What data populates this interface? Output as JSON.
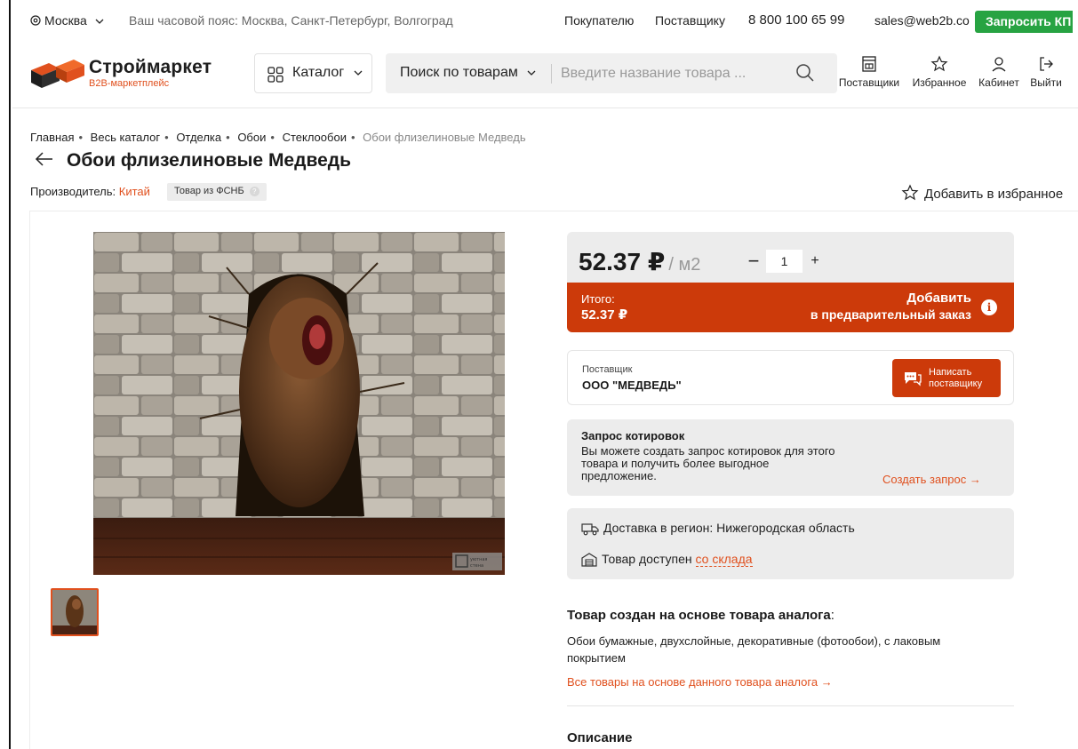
{
  "topbar": {
    "city": "Москва",
    "timezone": "Ваш часовой пояс: Москва, Санкт-Петербург, Волгоград",
    "buyer_link": "Покупателю",
    "supplier_link": "Поставщику",
    "phone": "8 800 100 65 99",
    "email": "sales@web2b.co",
    "kp_button": "Запросить КП"
  },
  "header": {
    "brand": "Строймаркет",
    "brand_sub": "B2B-маркетплейс",
    "catalog": "Каталог",
    "search_mode": "Поиск по товарам",
    "search_placeholder": "Введите название товара ...",
    "nav": {
      "suppliers": "Поставщики",
      "favorites": "Избранное",
      "cabinet": "Кабинет",
      "logout": "Выйти"
    }
  },
  "breadcrumb": {
    "items": [
      "Главная",
      "Весь каталог",
      "Отделка",
      "Обои",
      "Стеклообои"
    ],
    "current": "Обои флизелиновые Медведь"
  },
  "product": {
    "title": "Обои флизелиновые Медведь",
    "maker_label": "Производитель:",
    "maker_country": "Китай",
    "fsnb_badge": "Товар из ФСНБ",
    "fsnb_hint": "?",
    "add_favorite": "Добавить в избранное",
    "watermark": "уютная стена"
  },
  "price": {
    "value": "52.37 ₽",
    "unit": "/ м2",
    "qty_minus": "−",
    "quantity": "1",
    "qty_plus": "+",
    "total_label": "Итого:",
    "total_value": "52.37 ₽",
    "add_line1": "Добавить",
    "add_line2": "в предварительный заказ",
    "info": "i"
  },
  "supplier": {
    "label": "Поставщик",
    "name": "ООО \"МЕДВЕДЬ\"",
    "write_line1": "Написать",
    "write_line2": "поставщику"
  },
  "quote": {
    "title": "Запрос котировок",
    "text": "Вы можете создать запрос котировок для этого товара и получить более выгодное предложение.",
    "link": "Создать запрос →"
  },
  "delivery": {
    "region": "Доставка в регион: Нижегородская область",
    "stock_text": "Товар доступен",
    "stock_link": "со склада"
  },
  "analog": {
    "title": "Товар создан на основе товара аналога",
    "colon": ":",
    "text": "Обои бумажные, двухслойные, декоративные (фотообои), с лаковым покрытием",
    "link": "Все товары на основе данного товара аналога →"
  },
  "description": {
    "title": "Описание"
  },
  "colors": {
    "accent": "#e0501e",
    "order_bar": "#cc3a0a",
    "kp_green": "#27a342"
  }
}
